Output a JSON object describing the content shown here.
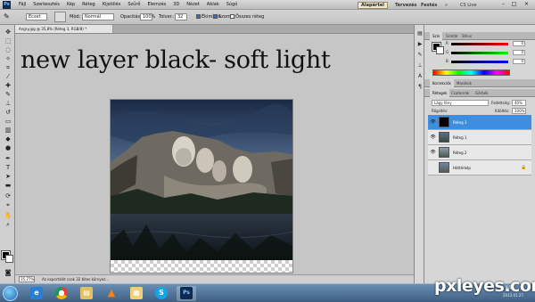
{
  "app": {
    "logo": "Ps",
    "menu": [
      "Fájl",
      "Szerkesztés",
      "Kép",
      "Réteg",
      "Kijelölés",
      "Szűrő",
      "Elemzés",
      "3D",
      "Nézet",
      "Ablak",
      "Súgó"
    ],
    "workspaces": {
      "active": "Alapértel",
      "drawing": "Tervezés",
      "painting": "Festés",
      "more": "»"
    },
    "cs_live": "CS Live",
    "window_buttons": {
      "minimize": "–",
      "maximize": "□",
      "close": "×"
    }
  },
  "options": {
    "brush_mode_select": "Ecset",
    "mode_label": "Mód:",
    "mode_value": "Normál",
    "opacity_label": "Opacitás:",
    "opacity_value": "100%",
    "flow_label": "Tolver.:",
    "flow_value": "32",
    "erase_to_history": "Ékimítés",
    "smooth": "Szomat",
    "sample_all_layers": "Összes réteg"
  },
  "document": {
    "tab_title": "Angry.jpg @ 35,8% (Réteg 3, RGB/8) *",
    "annotation": "new layer black- soft light",
    "zoom": "35,77%",
    "status": "Az exportálót csak 32 bites környez..."
  },
  "color_panel": {
    "tabs": [
      "Szín",
      "Színtár",
      "Stílus"
    ],
    "rows": [
      {
        "label": "R",
        "value": "0"
      },
      {
        "label": "G",
        "value": "0"
      },
      {
        "label": "B",
        "value": "0"
      }
    ]
  },
  "adjust_tabs": [
    "Korrekciók",
    "Maszkok"
  ],
  "layers_panel": {
    "tabs": [
      "Rétegek",
      "Csatornák",
      "Görbék"
    ],
    "blend_mode": "Lágy fény",
    "opacity_label": "Fedettség:",
    "opacity_value": "40%",
    "lock_label": "Rögzítés:",
    "fill_label": "Kitöltés:",
    "fill_value": "100%",
    "layers": [
      {
        "name": "Réteg 3",
        "selected": true
      },
      {
        "name": "Réteg 1",
        "selected": false
      },
      {
        "name": "Réteg 2",
        "selected": false
      },
      {
        "name": "Háttérkép",
        "selected": false
      }
    ]
  },
  "taskbar": {
    "apps": [
      "internet-explorer",
      "chrome",
      "file-explorer",
      "vlc",
      "folders",
      "skype",
      "photoshop"
    ],
    "time": "9:53",
    "date": "2013.01.27."
  },
  "watermark": "pxleyes.com"
}
